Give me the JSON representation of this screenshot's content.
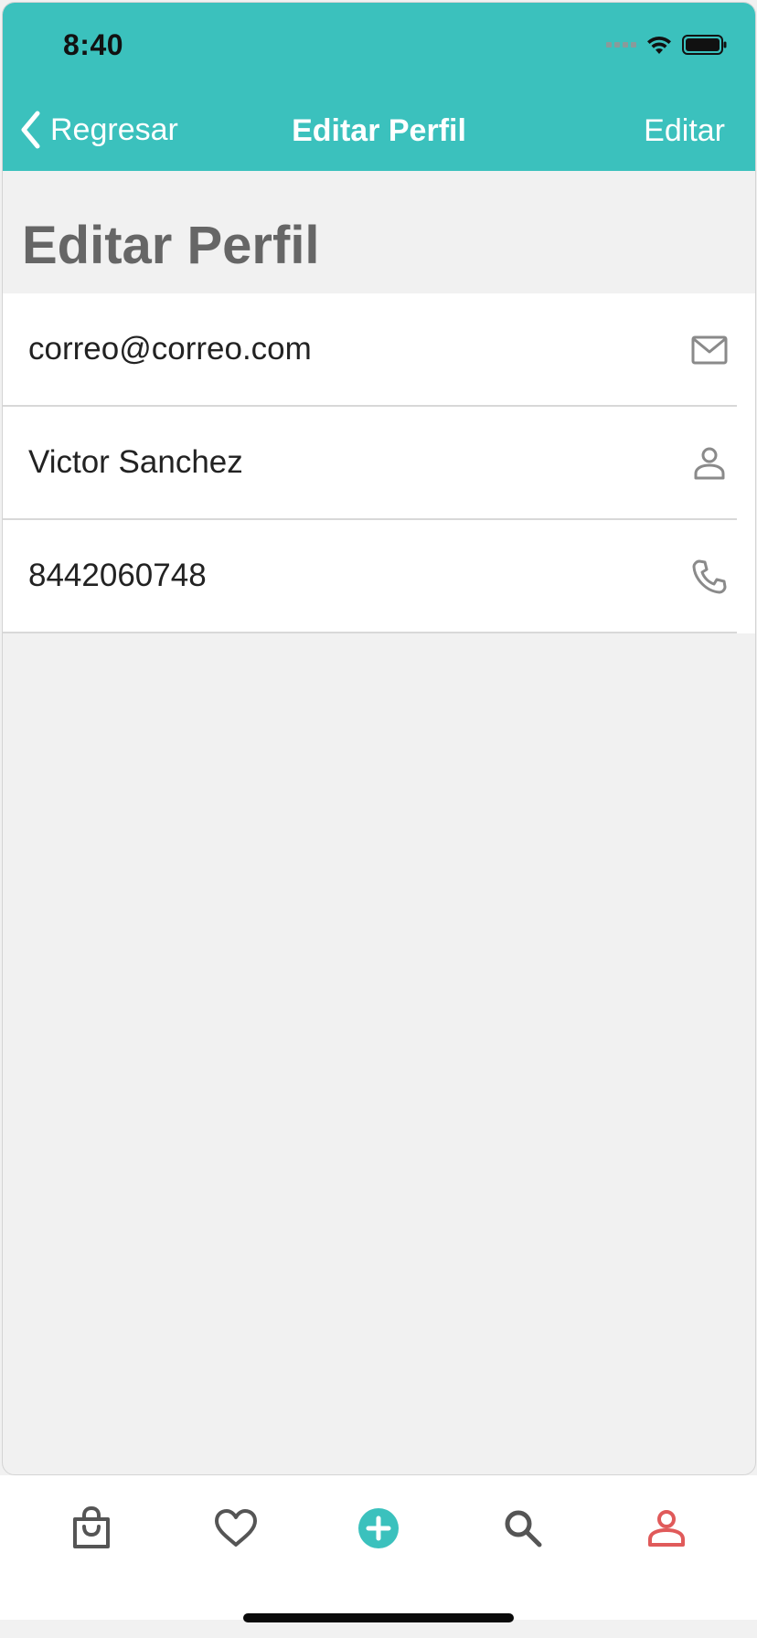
{
  "status_bar": {
    "time": "8:40"
  },
  "nav": {
    "back_label": "Regresar",
    "title": "Editar Perfil",
    "edit_label": "Editar"
  },
  "page": {
    "title": "Editar Perfil"
  },
  "fields": [
    {
      "value": "correo@correo.com",
      "icon": "mail-icon"
    },
    {
      "value": "Victor Sanchez",
      "icon": "person-icon"
    },
    {
      "value": "8442060748",
      "icon": "phone-icon"
    }
  ],
  "tabbar": {
    "items": [
      {
        "icon": "shopping-bag-icon",
        "active": false
      },
      {
        "icon": "heart-icon",
        "active": false
      },
      {
        "icon": "add-circle-icon",
        "active": false
      },
      {
        "icon": "search-icon",
        "active": false
      },
      {
        "icon": "profile-icon",
        "active": true
      }
    ]
  },
  "colors": {
    "header": "#3bc1bd",
    "accent": "#3bc1bd",
    "active_tab": "#e05a5a",
    "icon_gray": "#555555"
  }
}
